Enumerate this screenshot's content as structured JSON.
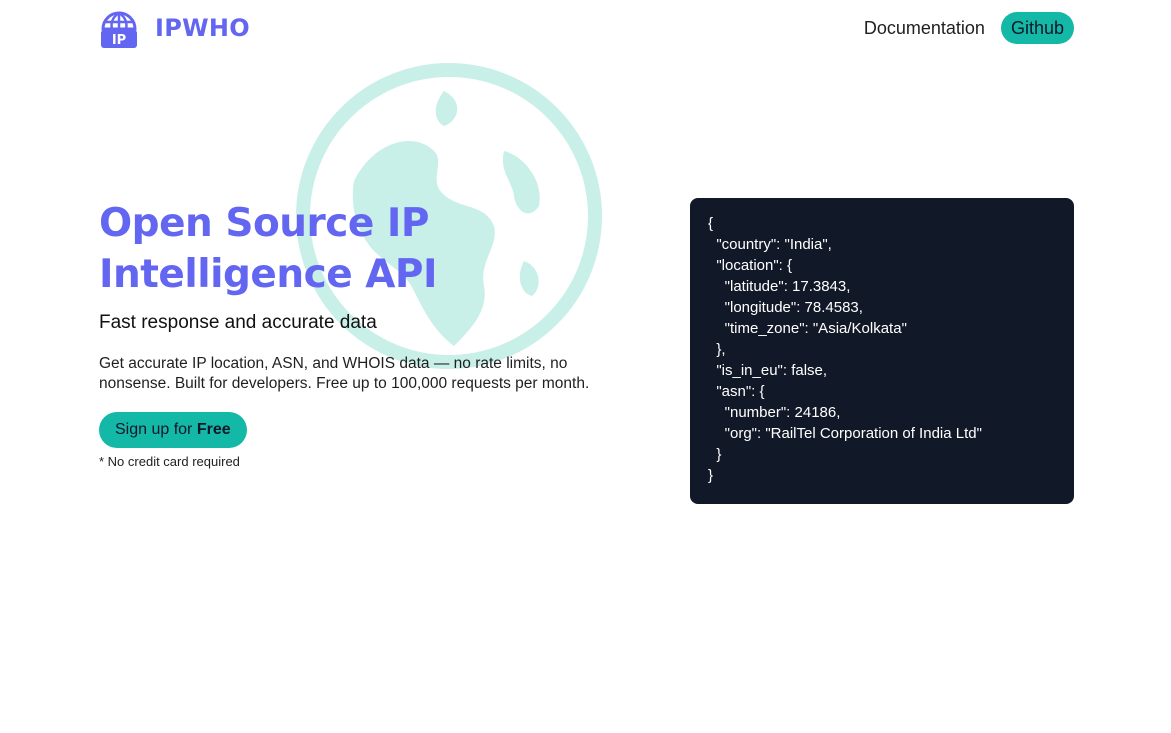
{
  "header": {
    "brand": "IPWHO",
    "logo_text": "IP",
    "nav": {
      "documentation": "Documentation",
      "github": "Github"
    }
  },
  "hero": {
    "title_line1": "Open Source IP",
    "title_line2": "Intelligence API",
    "subtitle": "Fast response and accurate data",
    "description": "Get accurate IP location, ASN, and WHOIS data — no rate limits, no nonsense. Built for developers. Free up to 100,000 requests per month.",
    "cta_prefix": "Sign up for ",
    "cta_strong": "Free",
    "note": "* No credit card required"
  },
  "code_sample": "{\n  \"country\": \"India\",\n  \"location\": {\n    \"latitude\": 17.3843,\n    \"longitude\": 78.4583,\n    \"time_zone\": \"Asia/Kolkata\"\n  },\n  \"is_in_eu\": false,\n  \"asn\": {\n    \"number\": 24186,\n    \"org\": \"RailTel Corporation of India Ltd\"\n  }\n}",
  "colors": {
    "brand": "#6366f1",
    "accent": "#14b8a6",
    "globe": "#c9efe9",
    "code_bg": "#111827"
  },
  "icons": {
    "logo": "globe-ip-logo-icon",
    "hero_background": "globe-icon"
  }
}
